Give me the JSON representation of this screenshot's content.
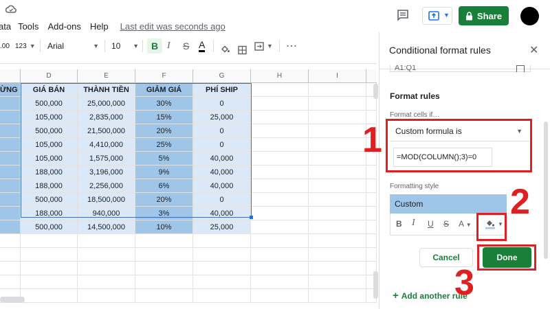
{
  "menu": {
    "items": [
      "ata",
      "Tools",
      "Add-ons",
      "Help"
    ],
    "last_edit": "Last edit was seconds ago"
  },
  "header": {
    "share_label": "Share"
  },
  "toolbar": {
    "decimal_label": ".00",
    "format_label": "123",
    "font_name": "Arial",
    "font_size": "10",
    "bold": "B",
    "italic": "I",
    "strike": "S",
    "textcolor": "A",
    "more": "⋮"
  },
  "columns": [
    "D",
    "E",
    "F",
    "G",
    "H",
    "I"
  ],
  "table": {
    "headers": [
      "ỪNG",
      "GIÁ BÁN",
      "THÀNH TIỀN",
      "GIẢM GIÁ",
      "PHÍ SHIP"
    ],
    "rows": [
      [
        "500,000",
        "25,000,000",
        "30%",
        "0"
      ],
      [
        "105,000",
        "2,835,000",
        "15%",
        "25,000"
      ],
      [
        "500,000",
        "21,500,000",
        "20%",
        "0"
      ],
      [
        "105,000",
        "4,410,000",
        "25%",
        "0"
      ],
      [
        "105,000",
        "1,575,000",
        "5%",
        "40,000"
      ],
      [
        "188,000",
        "3,196,000",
        "9%",
        "40,000"
      ],
      [
        "188,000",
        "2,256,000",
        "6%",
        "40,000"
      ],
      [
        "500,000",
        "18,500,000",
        "20%",
        "0"
      ],
      [
        "188,000",
        "940,000",
        "3%",
        "40,000"
      ],
      [
        "500,000",
        "14,500,000",
        "10%",
        "25,000"
      ]
    ]
  },
  "panel": {
    "title": "Conditional format rules",
    "range_text": "A1:Q1",
    "format_rules": "Format rules",
    "format_cells_if": "Format cells if…",
    "condition": "Custom formula is",
    "formula": "=MOD(COLUMN();3)=0",
    "formatting_style": "Formatting style",
    "style_preview": "Custom",
    "cancel": "Cancel",
    "done": "Done",
    "add_another": "Add another rule"
  },
  "annotations": {
    "n1": "1",
    "n2": "2",
    "n3": "3",
    "color": "#e02020"
  }
}
